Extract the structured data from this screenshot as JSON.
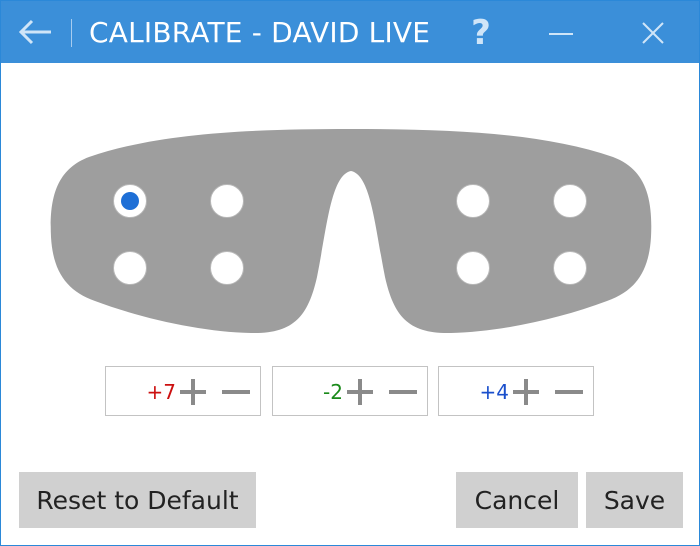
{
  "window": {
    "title": "CALIBRATE - DAVID LIVE",
    "help_label": "?",
    "back_icon": "arrow-left-icon",
    "minimize_icon": "minimize-icon",
    "close_icon": "close-icon",
    "accent_color": "#3b8fd9"
  },
  "mask": {
    "color": "#9e9e9e",
    "selected_color": "#1e6fd6",
    "points": [
      {
        "id": "left-top-outer",
        "selected": true
      },
      {
        "id": "left-top-inner",
        "selected": false
      },
      {
        "id": "left-bottom-outer",
        "selected": false
      },
      {
        "id": "left-bottom-inner",
        "selected": false
      },
      {
        "id": "right-top-inner",
        "selected": false
      },
      {
        "id": "right-top-outer",
        "selected": false
      },
      {
        "id": "right-bottom-inner",
        "selected": false
      },
      {
        "id": "right-bottom-outer",
        "selected": false
      }
    ]
  },
  "steppers": [
    {
      "value": "+7",
      "color": "#cc1010"
    },
    {
      "value": "-2",
      "color": "#1a8a1a"
    },
    {
      "value": "+4",
      "color": "#1a4fcc"
    }
  ],
  "buttons": {
    "reset": "Reset to Default",
    "cancel": "Cancel",
    "save": "Save"
  }
}
